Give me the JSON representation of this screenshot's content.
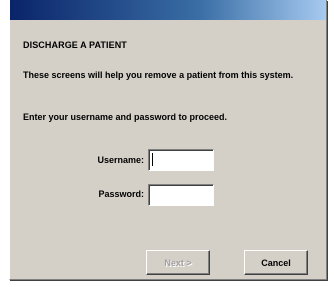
{
  "dialog": {
    "heading": "DISCHARGE A PATIENT",
    "intro": "These screens will help you remove a patient from this system.",
    "instruction": "Enter your username and password to proceed."
  },
  "form": {
    "username_label": "Username:",
    "username_value": "",
    "password_label": "Password:",
    "password_value": ""
  },
  "buttons": {
    "next_label": "Next >",
    "next_enabled": false,
    "cancel_label": "Cancel"
  },
  "colors": {
    "dialog_bg": "#d4d0c8",
    "titlebar_start": "#0a246a",
    "titlebar_end": "#a6caf0"
  }
}
